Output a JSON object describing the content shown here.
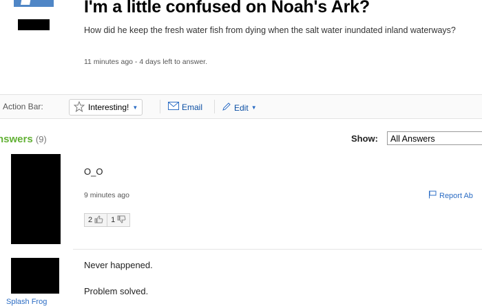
{
  "question": {
    "title": "I'm a little confused on Noah's Ark?",
    "body": "How did he keep the fresh water fish from dying when the salt water inundated inland waterways?",
    "meta": "11 minutes ago - 4 days left to answer."
  },
  "action_bar": {
    "label": "Action Bar:",
    "interesting": "Interesting!",
    "email": "Email",
    "edit": "Edit"
  },
  "answers": {
    "title": "nswers",
    "count": "(9)",
    "show_label": "Show:",
    "show_value": "All Answers",
    "items": [
      {
        "text": "O_O",
        "time": "9 minutes ago",
        "report": "Report Ab",
        "thumbs_up": "2",
        "thumbs_down": "1"
      },
      {
        "user": "Splash Frog",
        "line1": "Never happened.",
        "line2": "Problem solved."
      }
    ]
  },
  "colors": {
    "link": "#2b6cc4",
    "answers_green": "#62b135"
  }
}
